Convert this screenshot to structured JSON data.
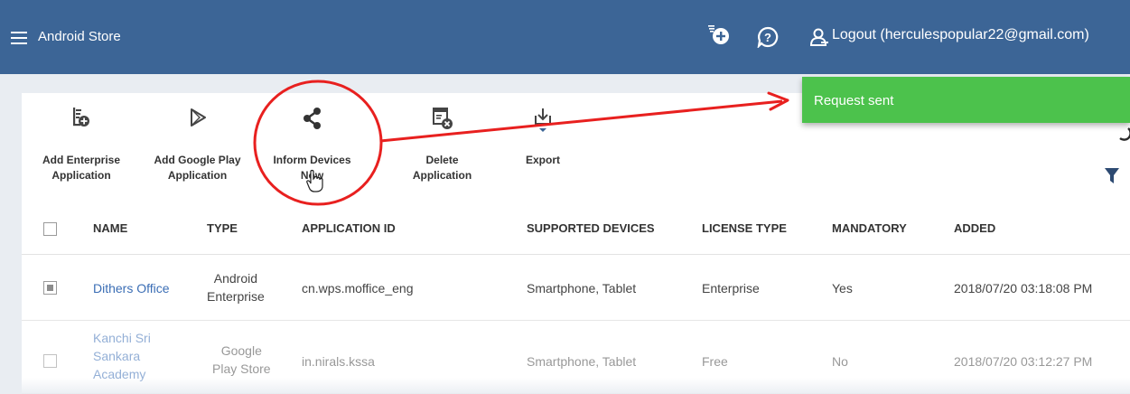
{
  "header": {
    "app_title": "Android Store",
    "logout_text": "Logout (herculespopular22@gmail.com)",
    "bg_color": "#3c6596"
  },
  "toolbar": {
    "add_enterprise_label": "Add Enterprise\nApplication",
    "add_google_play_label": "Add Google Play\nApplication",
    "inform_devices_label": "Inform Devices\nNow",
    "delete_label": "Delete\nApplication",
    "export_label": "Export"
  },
  "table": {
    "headers": {
      "name": "NAME",
      "type": "TYPE",
      "app_id": "APPLICATION ID",
      "supported": "SUPPORTED DEVICES",
      "license": "LICENSE TYPE",
      "mandatory": "MANDATORY",
      "added": "ADDED"
    },
    "rows": [
      {
        "checked": true,
        "name": "Dithers Office",
        "type": "Android\nEnterprise",
        "app_id": "cn.wps.moffice_eng",
        "supported": "Smartphone, Tablet",
        "license": "Enterprise",
        "mandatory": "Yes",
        "added": "2018/07/20 03:18:08 PM"
      },
      {
        "checked": false,
        "name": "Kanchi Sri\nSankara\nAcademy",
        "type": "Google\nPlay Store",
        "app_id": "in.nirals.kssa",
        "supported": "Smartphone, Tablet",
        "license": "Free",
        "mandatory": "No",
        "added": "2018/07/20 03:12:27 PM"
      }
    ]
  },
  "toast": {
    "message": "Request sent",
    "color": "#4cc24c"
  },
  "annotation": {
    "color": "#e8201f"
  }
}
